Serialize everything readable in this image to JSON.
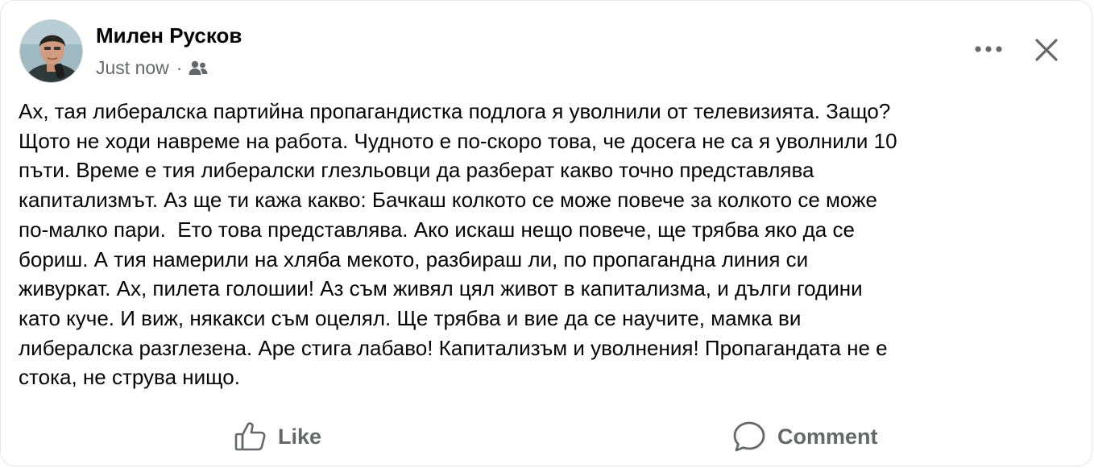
{
  "post": {
    "author": "Милен Русков",
    "timestamp": "Just now",
    "separator": "·",
    "audience_icon": "friends-icon",
    "text_lines": [
      "Ах, тая либералска партийна пропагандистка подлога я уволнили от телевизията. Защо?",
      "Щото не ходи навреме на работа. Чудното е по-скоро това, че досега не са я уволнили 10",
      "пъти. Време е тия либералски глезльовци да разберат какво точно представлява",
      "капитализмът. Аз ще ти кажа какво: Бачкаш колкото се може повече за колкото се може",
      "по-малко пари.  Ето това представлява. Ако искаш нещо повече, ще трябва яко да се",
      "бориш. А тия намерили на хляба мекото, разбираш ли, по пропагандна линия си",
      "живуркат. Ах, пилета голошии! Аз съм живял цял живот в капитализма, и дълги години",
      "като куче. И виж, някакси съм оцелял. Ще трябва и вие да се научите, мамка ви",
      "либералска разглезена. Аре стига лабаво! Капитализъм и уволнения! Пропагандата не е",
      "стока, не струва нищо."
    ]
  },
  "header_actions": {
    "more_icon": "more-horizontal-icon",
    "close_icon": "close-icon"
  },
  "actions": {
    "like_label": "Like",
    "like_icon": "thumbs-up-icon",
    "comment_label": "Comment",
    "comment_icon": "comment-bubble-icon"
  },
  "colors": {
    "text_primary": "#050505",
    "text_secondary": "#65676b",
    "card_border": "#e4e6eb"
  }
}
